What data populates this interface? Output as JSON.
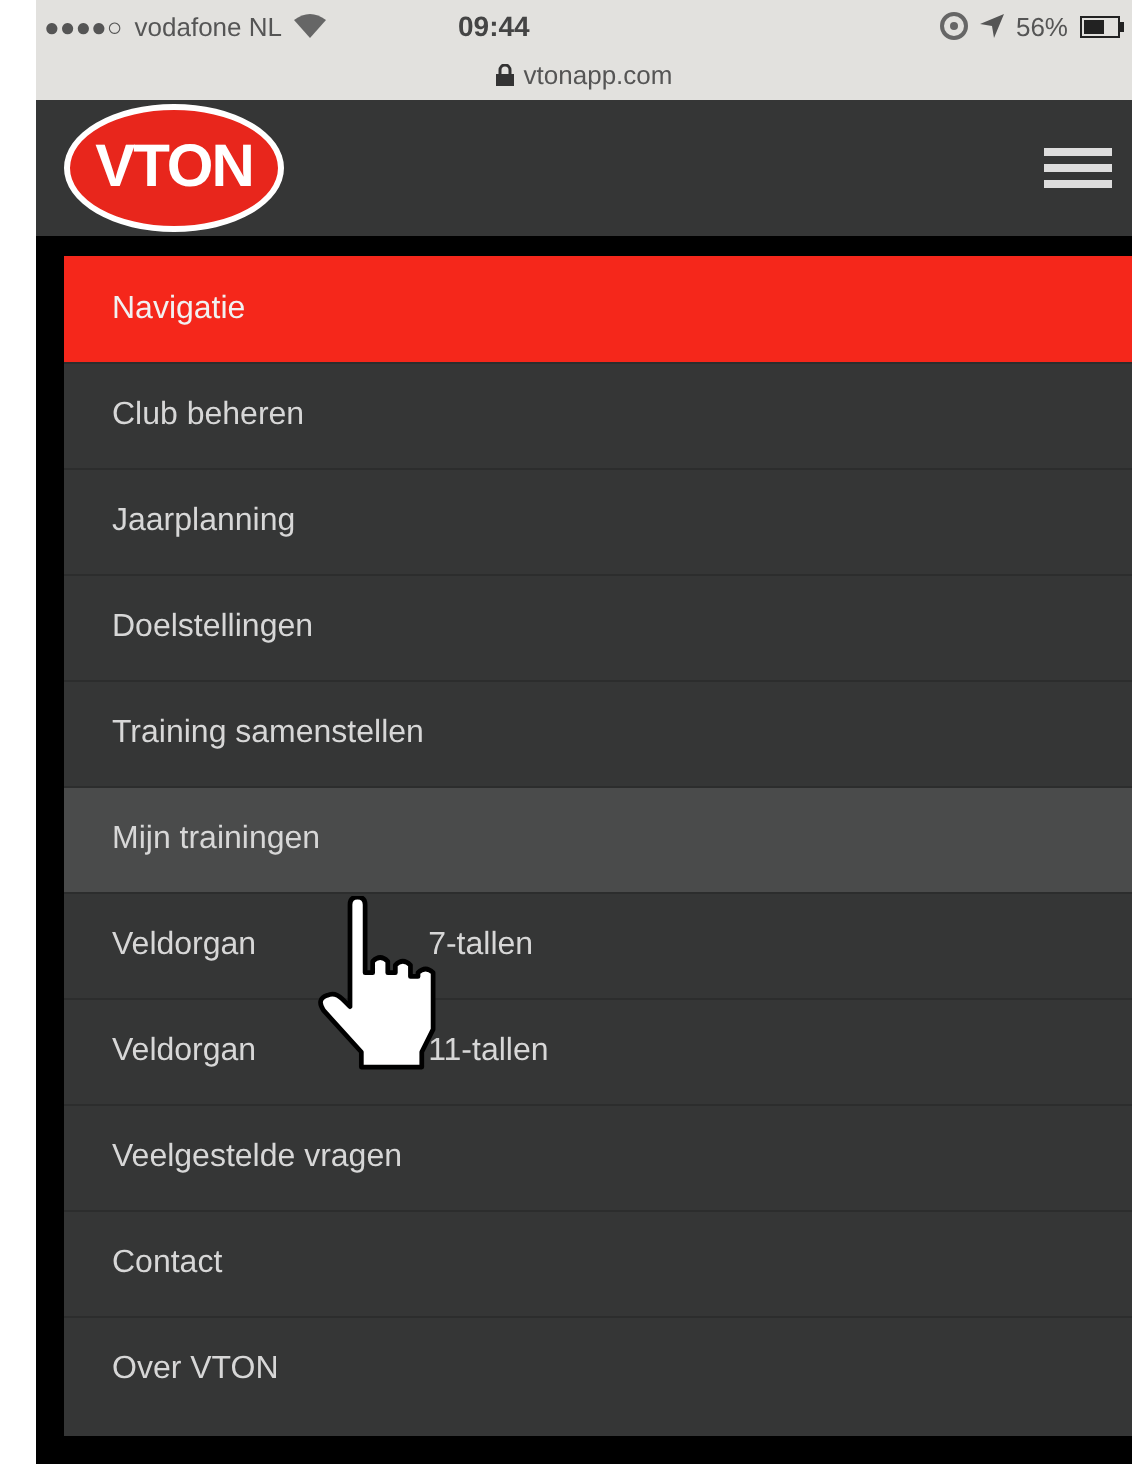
{
  "status_bar": {
    "signal": "●●●●○",
    "carrier": "vodafone NL",
    "time": "09:44",
    "battery": "56%"
  },
  "address_bar": {
    "url": "vtonapp.com"
  },
  "header": {
    "logo": "VTON"
  },
  "menu": {
    "title": "Navigatie",
    "items": [
      {
        "label": "Club beheren",
        "selected": false
      },
      {
        "label": "Jaarplanning",
        "selected": false
      },
      {
        "label": "Doelstellingen",
        "selected": false
      },
      {
        "label": "Training samenstellen",
        "selected": false
      },
      {
        "label": "Mijn trainingen",
        "selected": true
      },
      {
        "label": "Veldorgan",
        "label_end": "7-tallen",
        "selected": false
      },
      {
        "label": "Veldorgan",
        "label_end": "11-tallen",
        "selected": false
      },
      {
        "label": "Veelgestelde vragen",
        "selected": false
      },
      {
        "label": "Contact",
        "selected": false
      },
      {
        "label": "Over VTON",
        "selected": false
      }
    ]
  },
  "cursor": {
    "kind": "hand"
  }
}
